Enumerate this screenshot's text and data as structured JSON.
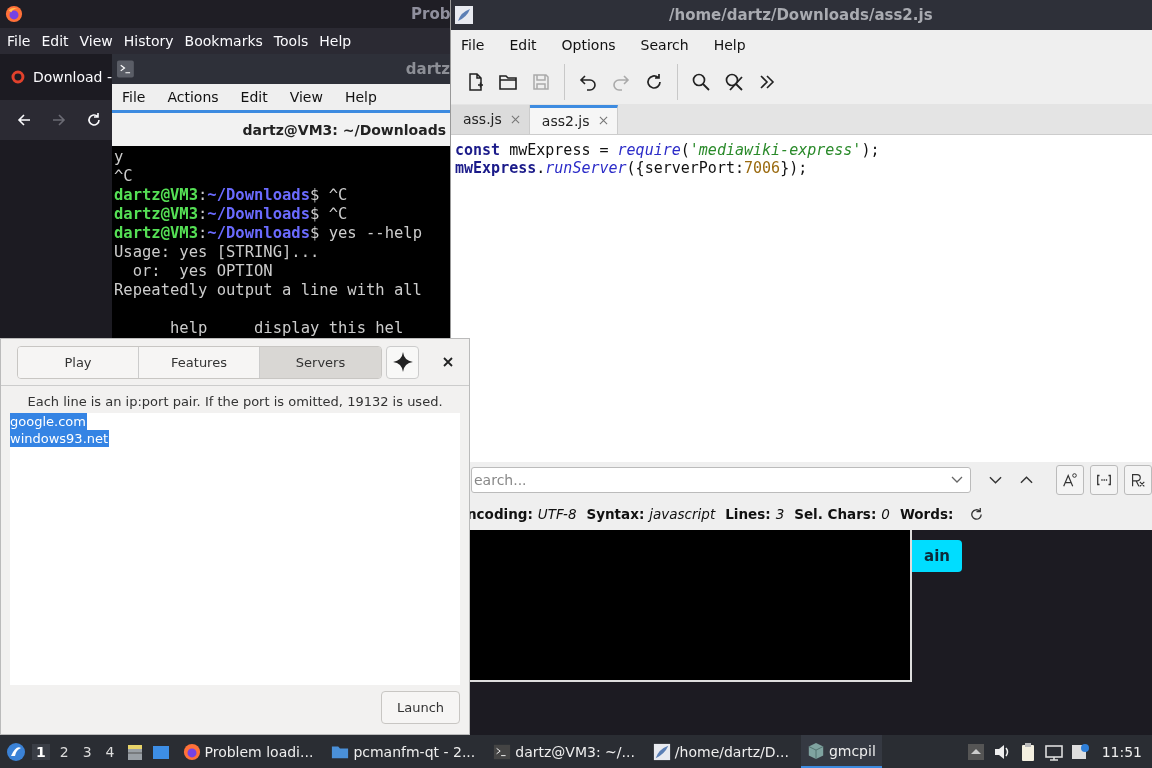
{
  "browser": {
    "title": "Prob",
    "menu": [
      "File",
      "Edit",
      "View",
      "History",
      "Bookmarks",
      "Tools",
      "Help"
    ],
    "tab": {
      "label": "Download -"
    },
    "nav": [
      {
        "kind": "back",
        "disabled": false
      },
      {
        "kind": "forward",
        "disabled": true
      },
      {
        "kind": "reload",
        "disabled": false
      }
    ],
    "page_button": {
      "label": "ain"
    }
  },
  "terminal": {
    "title": "dartz",
    "menu": [
      "File",
      "Actions",
      "Edit",
      "View",
      "Help"
    ],
    "tab": {
      "label": "dartz@VM3: ~/Downloads"
    },
    "lines": [
      {
        "kind": "output",
        "text": "y"
      },
      {
        "kind": "output",
        "text": "^C"
      },
      {
        "kind": "prompt",
        "user": "dartz@VM3",
        "separator": ":",
        "path": "~/Downloads",
        "symbol": "$",
        "command": "^C"
      },
      {
        "kind": "prompt",
        "user": "dartz@VM3",
        "separator": ":",
        "path": "~/Downloads",
        "symbol": "$",
        "command": "^C"
      },
      {
        "kind": "prompt",
        "user": "dartz@VM3",
        "separator": ":",
        "path": "~/Downloads",
        "symbol": "$",
        "command": "yes --help"
      },
      {
        "kind": "output",
        "text": "Usage: yes [STRING]..."
      },
      {
        "kind": "output",
        "text": "  or:  yes OPTION"
      },
      {
        "kind": "output",
        "text": "Repeatedly output a line with all"
      },
      {
        "kind": "blank"
      },
      {
        "kind": "output",
        "text": "      help     display this hel"
      }
    ]
  },
  "editor": {
    "title": "/home/dartz/Downloads/ass2.js",
    "menu": [
      "File",
      "Edit",
      "Options",
      "Search",
      "Help"
    ],
    "toolbar": [
      [
        {
          "kind": "new",
          "disabled": false
        },
        {
          "kind": "open",
          "disabled": false
        },
        {
          "kind": "save",
          "disabled": true
        }
      ],
      [
        {
          "kind": "undo",
          "disabled": false
        },
        {
          "kind": "redo",
          "disabled": true
        },
        {
          "kind": "reload",
          "disabled": false
        }
      ],
      [
        {
          "kind": "find",
          "disabled": false
        },
        {
          "kind": "replace",
          "disabled": false
        },
        {
          "kind": "more",
          "disabled": false
        }
      ]
    ],
    "tabs": [
      {
        "label": "ass.js",
        "selected": false
      },
      {
        "label": "ass2.js",
        "selected": true
      }
    ],
    "code": [
      [
        {
          "kind": "keyword",
          "text": "const"
        },
        {
          "kind": "plain",
          "text": " mwExpress = "
        },
        {
          "kind": "function",
          "text": "require"
        },
        {
          "kind": "plain",
          "text": "("
        },
        {
          "kind": "string",
          "text": "'mediawiki-express'"
        },
        {
          "kind": "plain",
          "text": ");"
        }
      ],
      [
        {
          "kind": "keyword",
          "text": "mwExpress"
        },
        {
          "kind": "plain",
          "text": "."
        },
        {
          "kind": "function",
          "text": "runServer"
        },
        {
          "kind": "plain",
          "text": "({serverPort:"
        },
        {
          "kind": "number",
          "text": "7006"
        },
        {
          "kind": "plain",
          "text": "});"
        }
      ]
    ],
    "search": {
      "placeholder": "earch..."
    },
    "status": [
      {
        "label": "ncoding:",
        "value": "UTF-8"
      },
      {
        "label": "Syntax:",
        "value": "javascript"
      },
      {
        "label": "Lines:",
        "value": "3"
      },
      {
        "label": "Sel. Chars:",
        "value": "0"
      },
      {
        "label": "Words:"
      }
    ]
  },
  "dialog": {
    "tabs": [
      {
        "label": "Play",
        "selected": false
      },
      {
        "label": "Features",
        "selected": false
      },
      {
        "label": "Servers",
        "selected": true
      }
    ],
    "hint": "Each line is an ip:port pair. If the port is omitted, 19132 is used.",
    "servers": [
      {
        "text": "google.com",
        "selected": true
      },
      {
        "text": "windows93.net",
        "selected": true
      }
    ],
    "launch": "Launch"
  },
  "taskbar": {
    "desktops": [
      {
        "label": "1",
        "selected": true
      },
      {
        "label": "2",
        "selected": false
      },
      {
        "label": "3",
        "selected": false
      },
      {
        "label": "4",
        "selected": false
      }
    ],
    "tasks": [
      {
        "kind": "browser",
        "label": "Problem loadi...",
        "selected": false
      },
      {
        "kind": "folder",
        "label": "pcmanfm-qt - 2...",
        "selected": false
      },
      {
        "kind": "terminal",
        "label": "dartz@VM3: ~/...",
        "selected": false
      },
      {
        "kind": "editor",
        "label": "/home/dartz/D...",
        "selected": false
      },
      {
        "kind": "cube",
        "label": "gmcpil",
        "selected": true
      }
    ],
    "clock": "11:51"
  }
}
